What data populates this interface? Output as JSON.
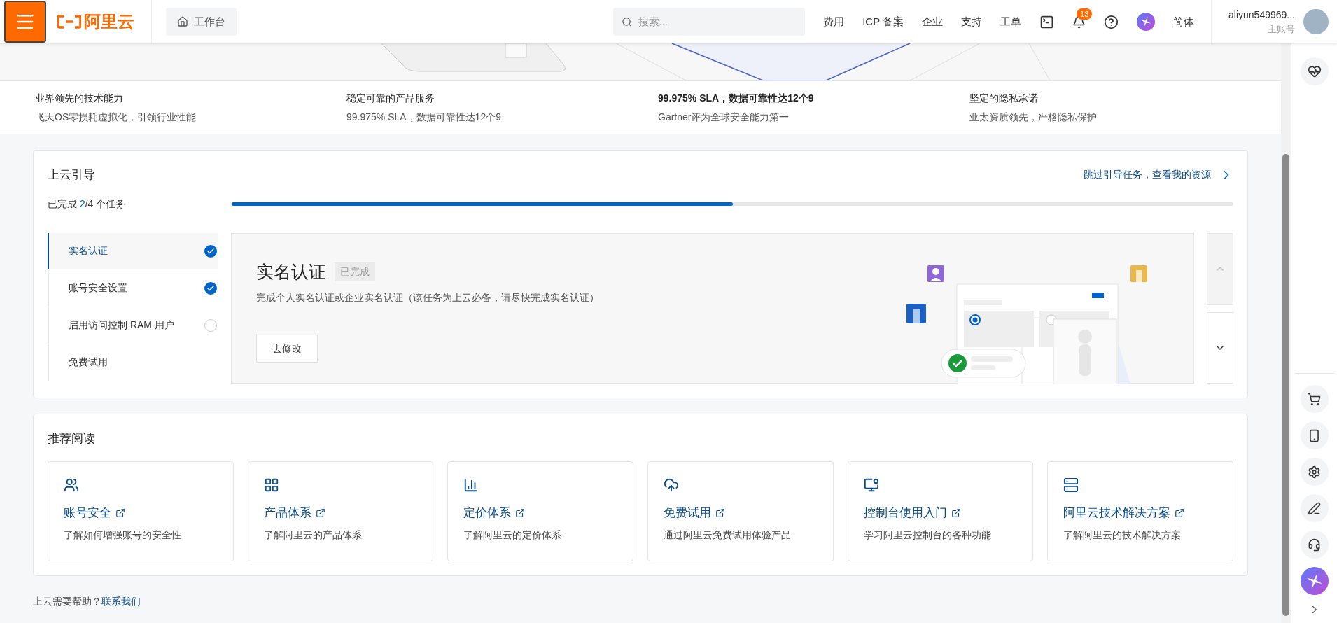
{
  "topbar": {
    "logo": "阿里云",
    "workspace": "工作台",
    "search": {
      "placeholder": "搜索..."
    },
    "nav": [
      "费用",
      "ICP 备案",
      "企业",
      "支持",
      "工单"
    ],
    "notifications": "13",
    "language": "简体",
    "account": {
      "name": "aliyun549969...",
      "role": "主账号"
    }
  },
  "features": [
    {
      "title": "业界领先的技术能力",
      "subtitle": "飞天OS零损耗虚拟化，引领行业性能",
      "bold": false
    },
    {
      "title": "稳定可靠的产品服务",
      "subtitle": "99.975% SLA，数据可靠性达12个9",
      "bold": false
    },
    {
      "title": "99.975% SLA，数据可靠性达12个9",
      "subtitle": "Gartner评为全球安全能力第一",
      "bold": true
    },
    {
      "title": "坚定的隐私承诺",
      "subtitle": "亚太资质领先，严格隐私保护",
      "bold": false
    }
  ],
  "guide": {
    "title": "上云引导",
    "skip_link": "跳过引导任务，查看我的资源",
    "progress": {
      "prefix": "已完成 ",
      "done": "2",
      "suffix": "/4 个任务",
      "level": 0.5
    },
    "tasks": [
      {
        "label": "实名认证",
        "selected": true,
        "kind": "done"
      },
      {
        "label": "账号安全设置",
        "selected": false,
        "kind": "done"
      },
      {
        "label": "启用访问控制 RAM 用户",
        "selected": false,
        "kind": "pending"
      },
      {
        "label": "免费试用",
        "selected": false,
        "kind": "plain"
      }
    ],
    "detail": {
      "title": "实名认证",
      "badge": "已完成",
      "description": "完成个人实名认证或企业实名认证（该任务为上云必备，请尽快完成实名认证）",
      "button": "去修改"
    }
  },
  "reading": {
    "title": "推荐阅读",
    "cards": [
      {
        "kind": "people",
        "title": "账号安全",
        "desc": "了解如何增强账号的安全性"
      },
      {
        "kind": "grid",
        "title": "产品体系",
        "desc": "了解阿里云的产品体系"
      },
      {
        "kind": "bars",
        "title": "定价体系",
        "desc": "了解阿里云的定价体系"
      },
      {
        "kind": "cloud",
        "title": "免费试用",
        "desc": "通过阿里云免费试用体验产品"
      },
      {
        "kind": "monitor",
        "title": "控制台使用入门",
        "desc": "学习阿里云控制台的各种功能"
      },
      {
        "kind": "server",
        "title": "阿里云技术解决方案",
        "desc": "了解阿里云的技术解决方案"
      }
    ]
  },
  "footer": {
    "text": "上云需要帮助？",
    "link": "联系我们"
  }
}
